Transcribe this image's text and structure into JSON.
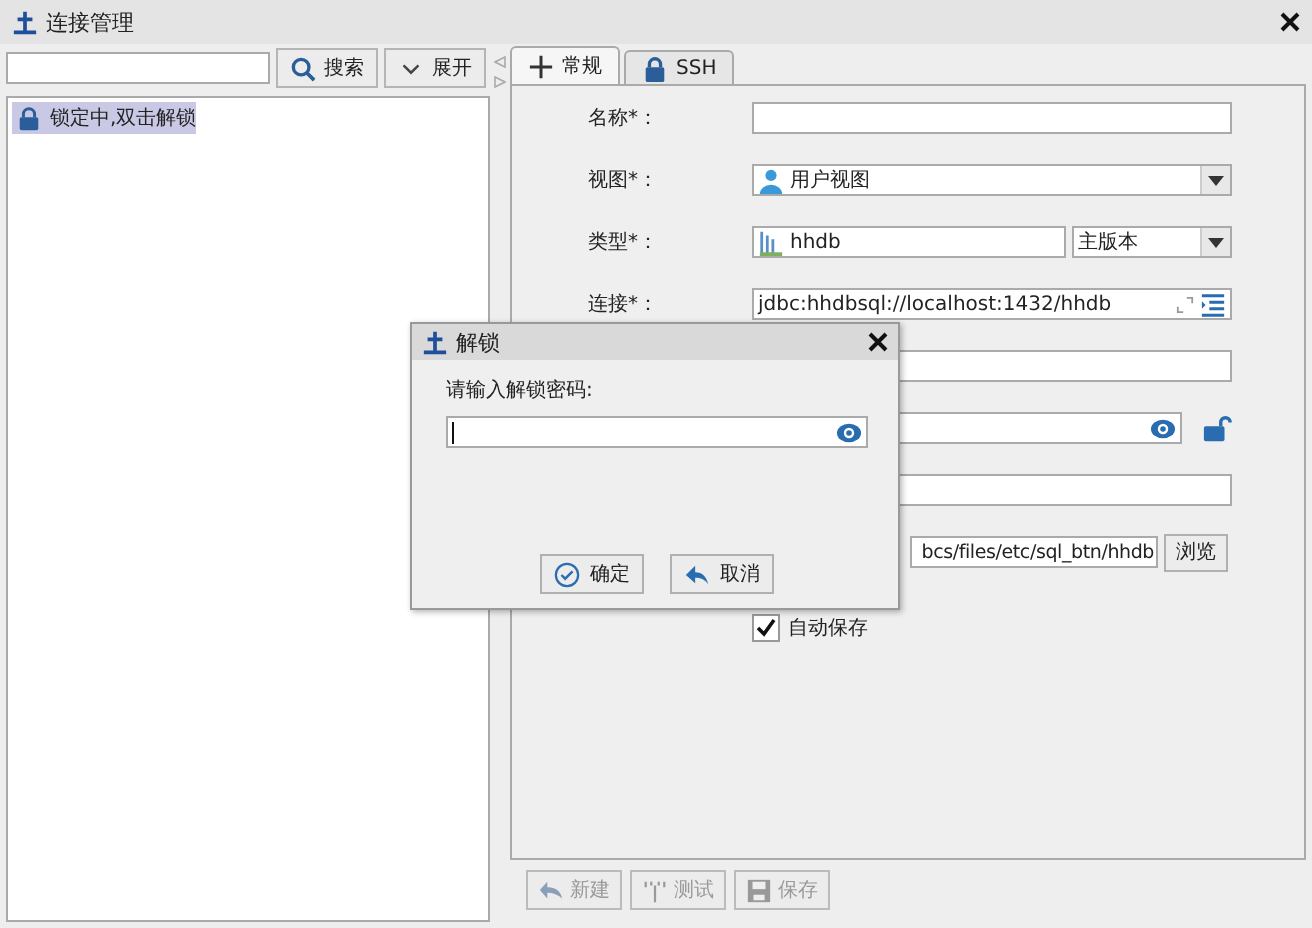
{
  "window": {
    "title": "连接管理"
  },
  "left": {
    "search_button": "搜索",
    "expand_button": "展开",
    "tree": [
      {
        "label": "锁定中,双击解锁",
        "selected": true
      }
    ]
  },
  "tabs": [
    {
      "label": "常规",
      "selected": true
    },
    {
      "label": "SSH",
      "selected": false
    }
  ],
  "form": [
    {
      "kind": "text",
      "label": "名称*："
    },
    {
      "kind": "select",
      "label": "视图*：",
      "value": "用户视图"
    },
    {
      "kind": "type",
      "label": "类型*：",
      "value": "hhdb",
      "version": "主版本"
    },
    {
      "kind": "connection",
      "label": "连接*：",
      "value": "jdbc:hhdbsql://localhost:1432/hhdb"
    },
    {
      "kind": "text"
    },
    {
      "kind": "password"
    },
    {
      "kind": "text"
    },
    {
      "kind": "browse",
      "value": "bcs/files/etc/sql_btn/hhdb",
      "button": "浏览"
    }
  ],
  "autosave": {
    "label": "自动保存",
    "checked": true
  },
  "bottom_buttons": [
    {
      "kind": "new",
      "label": "新建",
      "disabled": true
    },
    {
      "kind": "test",
      "label": "测试",
      "disabled": true
    },
    {
      "kind": "save",
      "label": "保存",
      "disabled": true
    }
  ],
  "dialog": {
    "title": "解锁",
    "prompt": "请输入解锁密码:",
    "ok": "确定",
    "cancel": "取消"
  }
}
